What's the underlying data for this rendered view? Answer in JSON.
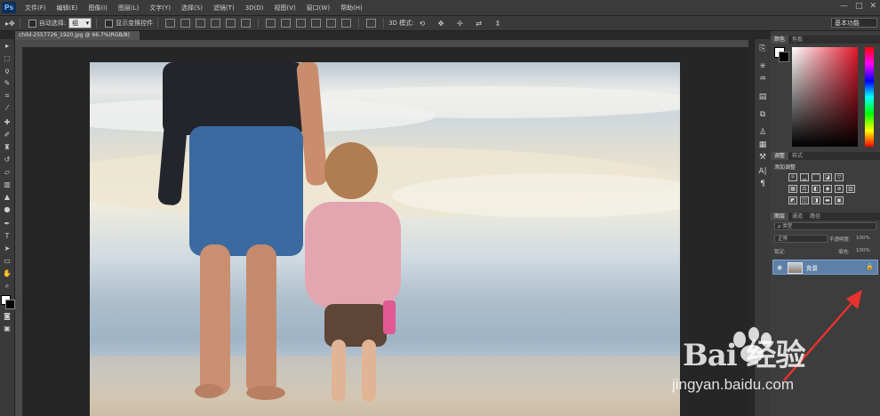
{
  "app": {
    "logo": "Ps",
    "window_controls": [
      "—",
      "□",
      "✕"
    ]
  },
  "menu": [
    "文件(F)",
    "编辑(E)",
    "图像(I)",
    "图层(L)",
    "文字(Y)",
    "选择(S)",
    "滤镜(T)",
    "3D(D)",
    "视图(V)",
    "窗口(W)",
    "帮助(H)"
  ],
  "options": {
    "auto_select_label": "自动选择:",
    "auto_select_value": "组",
    "show_transform_label": "显示变换控件",
    "mode_label": "3D 模式:"
  },
  "workspace": "基本功能",
  "document": {
    "tab_label": "child-2557726_1920.jpg @ 66.7%(RGB/8)"
  },
  "panels": {
    "color_tabs": [
      "颜色",
      "色板"
    ],
    "adjust_tabs": [
      "调整",
      "样式"
    ],
    "adjust_title": "添加调整",
    "layer_tabs": [
      "图层",
      "通道",
      "路径"
    ],
    "filter_kind": "ρ 类型",
    "blend_mode": "正常",
    "opacity_label": "不透明度:",
    "opacity_value": "100%",
    "lock_label": "锁定:",
    "fill_label": "填充:",
    "fill_value": "100%",
    "layer_name": "背景"
  },
  "watermark": {
    "brand": "Bai  经验",
    "url": "jingyan.baidu.com"
  },
  "colors": {
    "fg": "#ffffff",
    "bg": "#000000",
    "annotation": "#e8322e"
  }
}
